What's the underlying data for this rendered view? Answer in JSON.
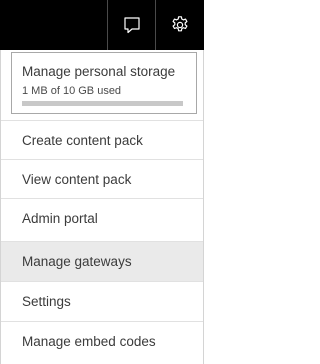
{
  "topbar": {
    "feedback_icon": "feedback-icon",
    "settings_icon": "gear-icon"
  },
  "storage": {
    "title": "Manage personal storage",
    "used_text": "1 MB of 10 GB used",
    "used_fraction": 0.0001
  },
  "menu": {
    "items": [
      {
        "label": "Create content pack"
      },
      {
        "label": "View content pack"
      },
      {
        "label": "Admin portal"
      },
      {
        "label": "Manage gateways",
        "selected": true
      },
      {
        "label": "Settings"
      },
      {
        "label": "Manage embed codes"
      }
    ]
  }
}
